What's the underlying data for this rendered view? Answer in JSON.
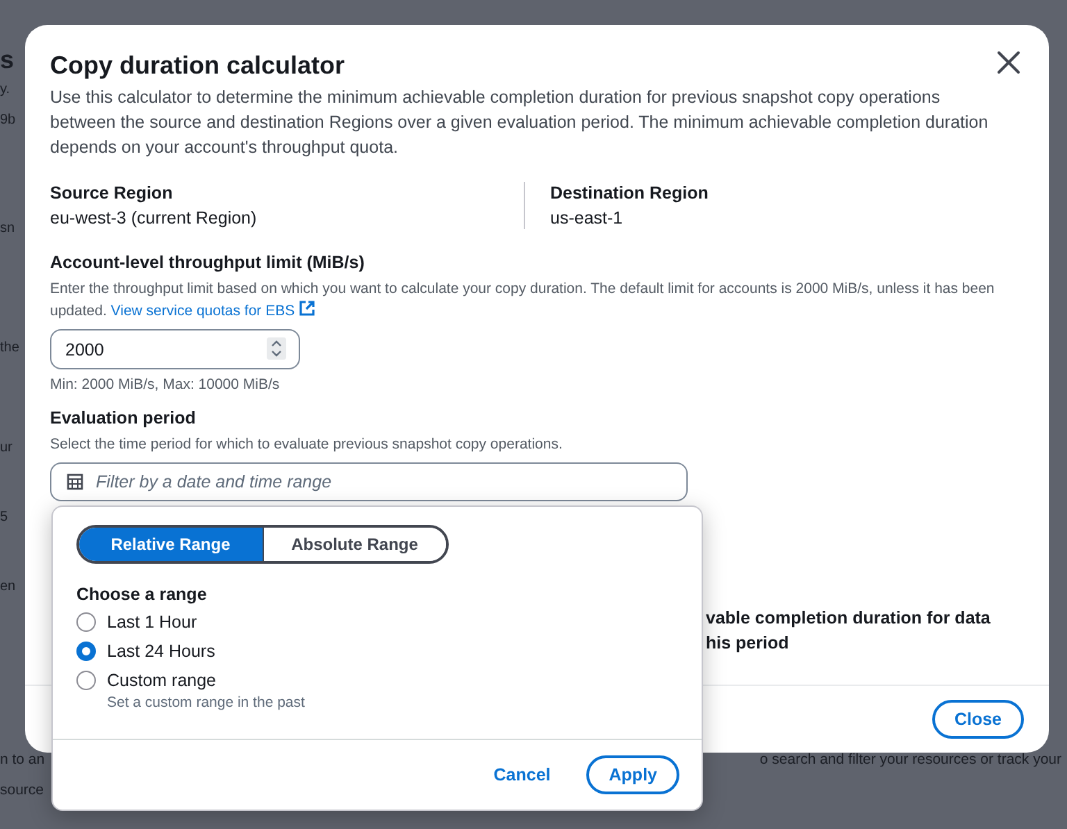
{
  "background": {
    "left_fragments": [
      "s",
      "y.",
      "9b",
      "sn",
      "the",
      "ur",
      "5",
      "en"
    ],
    "bottom_left": [
      "n to an",
      "source"
    ],
    "bottom_right": "o search and filter your resources or track your"
  },
  "modal": {
    "title": "Copy duration calculator",
    "description": "Use this calculator to determine the minimum achievable completion duration for previous snapshot copy operations between the source and destination Regions over a given evaluation period. The minimum achievable completion duration depends on your account's throughput quota.",
    "regions": [
      {
        "label": "Source Region",
        "value": "eu-west-3 (current Region)"
      },
      {
        "label": "Destination Region",
        "value": "us-east-1"
      }
    ],
    "throughput": {
      "label": "Account-level throughput limit (MiB/s)",
      "help": "Enter the throughput limit based on which you want to calculate your copy duration. The default limit for accounts is 2000 MiB/s, unless it has been updated.",
      "link": "View service quotas for EBS",
      "value": "2000",
      "constraint": "Min: 2000 MiB/s, Max: 10000 MiB/s"
    },
    "evaluation": {
      "label": "Evaluation period",
      "help": "Select the time period for which to evaluate previous snapshot copy operations.",
      "placeholder": "Filter by a date and time range"
    },
    "result_fragment": [
      "vable completion duration for data",
      "his period"
    ],
    "close_button": "Close"
  },
  "dropdown": {
    "tabs": [
      {
        "label": "Relative Range",
        "selected": true
      },
      {
        "label": "Absolute Range",
        "selected": false
      }
    ],
    "heading": "Choose a range",
    "options": [
      {
        "label": "Last 1 Hour",
        "selected": false
      },
      {
        "label": "Last 24 Hours",
        "selected": true
      },
      {
        "label": "Custom range",
        "selected": false,
        "description": "Set a custom range in the past"
      }
    ],
    "cancel": "Cancel",
    "apply": "Apply"
  }
}
